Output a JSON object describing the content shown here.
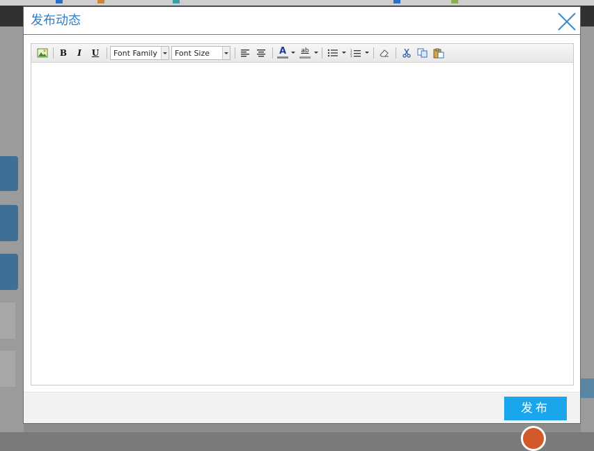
{
  "dialog": {
    "title": "发布动态",
    "close_icon": "close-icon"
  },
  "editor": {
    "toolbar": {
      "items": [
        {
          "name": "insert-image-icon"
        },
        {
          "name": "bold-button",
          "label": "B"
        },
        {
          "name": "italic-button",
          "label": "I"
        },
        {
          "name": "underline-button",
          "label": "U"
        },
        {
          "name": "align-left-icon"
        },
        {
          "name": "align-center-icon"
        },
        {
          "name": "font-color-icon",
          "label": "A"
        },
        {
          "name": "highlight-color-icon",
          "label": "ab"
        },
        {
          "name": "bullet-list-icon"
        },
        {
          "name": "numbered-list-icon"
        },
        {
          "name": "eraser-icon"
        },
        {
          "name": "cut-icon"
        },
        {
          "name": "copy-icon"
        },
        {
          "name": "paste-icon"
        }
      ],
      "font_family": "Font Family",
      "font_size": "Font Size"
    },
    "content": ""
  },
  "footer": {
    "publish_label": "发布"
  },
  "colors": {
    "accent": "#19a6ec",
    "title": "#2f7fc8",
    "header_line": "#3a8ad0"
  }
}
